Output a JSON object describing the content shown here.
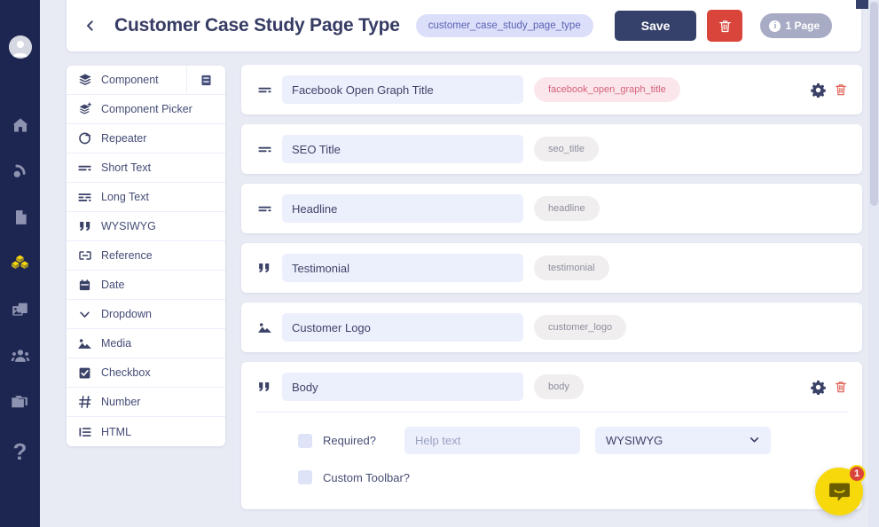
{
  "nav_rail": {
    "avatar": "user-avatar",
    "items": [
      {
        "icon": "home-icon",
        "name": "nav-home",
        "active": false
      },
      {
        "icon": "blog-icon",
        "name": "nav-blog",
        "active": false
      },
      {
        "icon": "page-icon",
        "name": "nav-pages",
        "active": false
      },
      {
        "icon": "components-icon",
        "name": "nav-components",
        "active": true
      },
      {
        "icon": "media-icon",
        "name": "nav-media",
        "active": false
      },
      {
        "icon": "users-icon",
        "name": "nav-users",
        "active": false
      },
      {
        "icon": "folder-icon",
        "name": "nav-files",
        "active": false
      },
      {
        "icon": "help-icon",
        "name": "nav-help",
        "active": false
      }
    ]
  },
  "header": {
    "back_icon": "chevron-left-icon",
    "title": "Customer Case Study Page Type",
    "slug": "customer_case_study_page_type",
    "save_label": "Save",
    "delete_icon": "trash-icon",
    "page_count": "1 Page",
    "info_glyph": "i"
  },
  "palette": {
    "toggle_icon": "book-view-icon",
    "items": [
      {
        "label": "Component",
        "icon": "layers-icon"
      },
      {
        "label": "Component Picker",
        "icon": "layers-plus-icon"
      },
      {
        "label": "Repeater",
        "icon": "refresh-icon"
      },
      {
        "label": "Short Text",
        "icon": "short-text-icon"
      },
      {
        "label": "Long Text",
        "icon": "long-text-icon"
      },
      {
        "label": "WYSIWYG",
        "icon": "quote-icon"
      },
      {
        "label": "Reference",
        "icon": "reference-icon"
      },
      {
        "label": "Date",
        "icon": "calendar-icon"
      },
      {
        "label": "Dropdown",
        "icon": "chevron-down-icon"
      },
      {
        "label": "Media",
        "icon": "image-icon"
      },
      {
        "label": "Checkbox",
        "icon": "checkbox-icon"
      },
      {
        "label": "Number",
        "icon": "hash-icon"
      },
      {
        "label": "HTML",
        "icon": "list-icon"
      }
    ]
  },
  "fields": [
    {
      "icon": "short-text-icon",
      "name": "Facebook Open Graph Title",
      "key": "facebook_open_graph_title",
      "key_state": "error",
      "show_actions": true,
      "expanded": false
    },
    {
      "icon": "short-text-icon",
      "name": "SEO Title",
      "key": "seo_title",
      "key_state": "normal",
      "show_actions": false,
      "expanded": false
    },
    {
      "icon": "short-text-icon",
      "name": "Headline",
      "key": "headline",
      "key_state": "normal",
      "show_actions": false,
      "expanded": false
    },
    {
      "icon": "quote-icon",
      "name": "Testimonial",
      "key": "testimonial",
      "key_state": "normal",
      "show_actions": false,
      "expanded": false
    },
    {
      "icon": "image-icon",
      "name": "Customer Logo",
      "key": "customer_logo",
      "key_state": "normal",
      "show_actions": false,
      "expanded": false
    },
    {
      "icon": "quote-icon",
      "name": "Body",
      "key": "body",
      "key_state": "normal",
      "show_actions": true,
      "expanded": true,
      "settings": {
        "required_label": "Required?",
        "required_checked": false,
        "help_placeholder": "Help text",
        "help_value": "",
        "type_value": "WYSIWYG",
        "custom_toolbar_label": "Custom Toolbar?",
        "custom_toolbar_checked": false
      }
    }
  ],
  "intercom": {
    "badge_count": "1",
    "icon": "chat-bubble-icon"
  },
  "colors": {
    "rail_bg": "#1d2551",
    "canvas_bg": "#e9ebf4",
    "accent_navy": "#36416b",
    "danger_red": "#d9453a",
    "slug_pill_bg": "#dcdffa",
    "slug_pill_text": "#5a62b4",
    "error_key_bg": "#fbe7eb",
    "error_key_text": "#d4607a",
    "intercom_yellow": "#f7d90b",
    "active_nav_yellow": "#f6d70a"
  }
}
